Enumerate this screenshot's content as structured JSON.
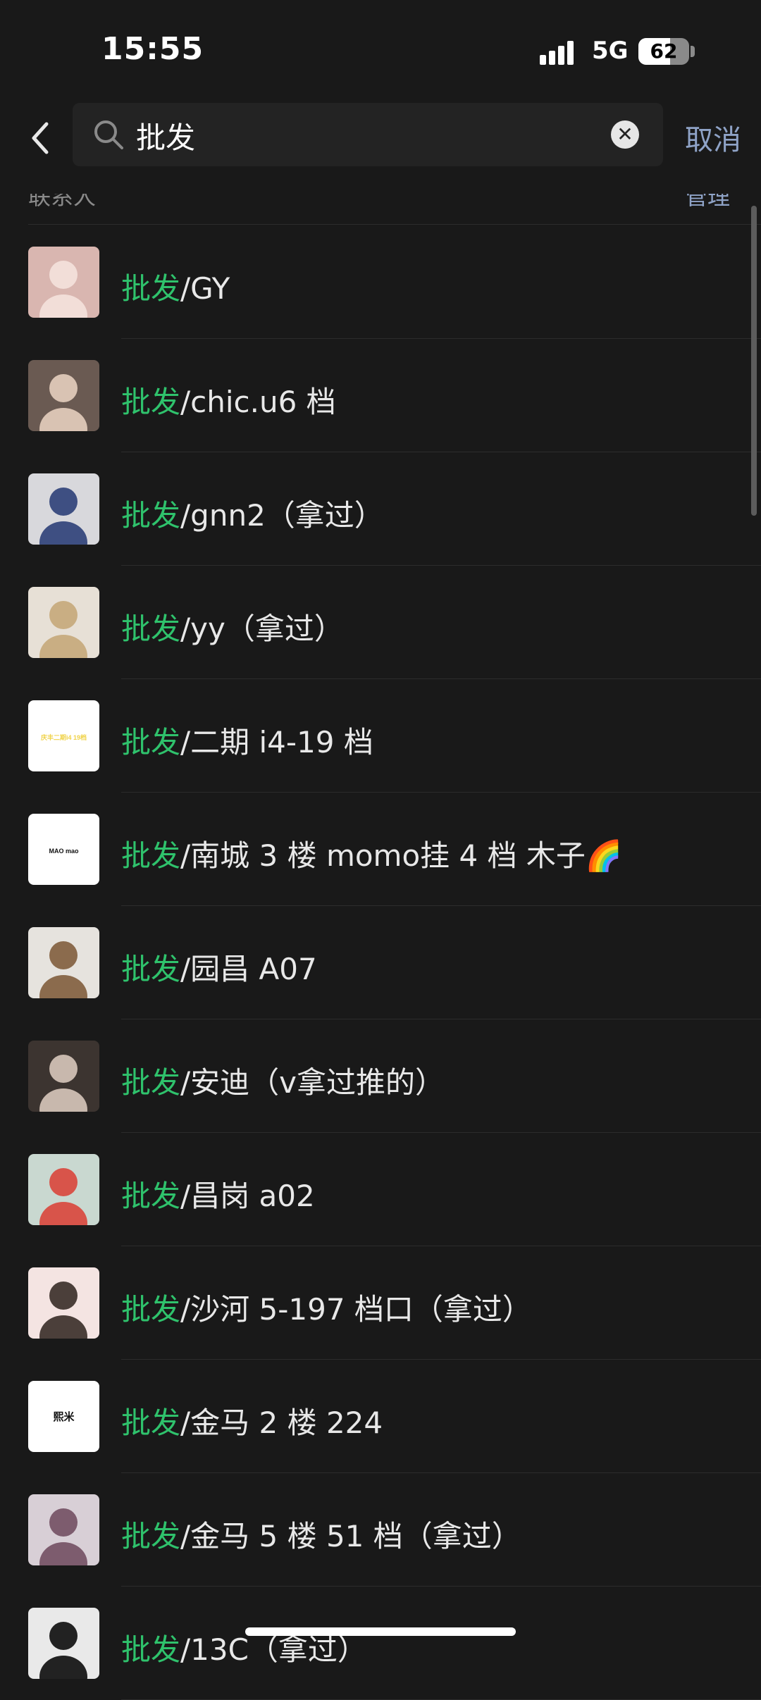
{
  "status_bar": {
    "time": "15:55",
    "network": "5G",
    "battery": "62",
    "battery_level": 0.62
  },
  "search": {
    "query": "批发",
    "cancel_label": "取消"
  },
  "section": {
    "title": "联系人",
    "manage_label": "管理"
  },
  "contacts": [
    {
      "highlight": "批发",
      "rest": "/GY",
      "avatar_bg": "#d9b6b0",
      "avatar_fg": "#f2ded8"
    },
    {
      "highlight": "批发",
      "rest": "/chic.u6 档",
      "avatar_bg": "#6a5a52",
      "avatar_fg": "#d9c3b3"
    },
    {
      "highlight": "批发",
      "rest": "/gnn2（拿过）",
      "avatar_bg": "#d8d8dc",
      "avatar_fg": "#3e4f82"
    },
    {
      "highlight": "批发",
      "rest": "/yy（拿过）",
      "avatar_bg": "#e7e0d6",
      "avatar_fg": "#c9ae83"
    },
    {
      "highlight": "批发",
      "rest": "/二期 i4-19 档",
      "avatar_bg": "#ffffff",
      "avatar_fg": "#f0d34a",
      "avatar_text": "庆丰二期i4 19档"
    },
    {
      "highlight": "批发",
      "rest": "/南城 3 楼 momo挂 4 档 木子🌈",
      "avatar_bg": "#ffffff",
      "avatar_fg": "#111111",
      "avatar_text": "MAO mao"
    },
    {
      "highlight": "批发",
      "rest": "/园昌 A07",
      "avatar_bg": "#e6e3de",
      "avatar_fg": "#8b6b4d"
    },
    {
      "highlight": "批发",
      "rest": "/安迪（v拿过推的）",
      "avatar_bg": "#3c3430",
      "avatar_fg": "#c8b8ad"
    },
    {
      "highlight": "批发",
      "rest": "/昌岗 a02",
      "avatar_bg": "#c9d8d0",
      "avatar_fg": "#d8544a"
    },
    {
      "highlight": "批发",
      "rest": "/沙河 5-197 档口（拿过）",
      "avatar_bg": "#f4e4e2",
      "avatar_fg": "#4b3f3a"
    },
    {
      "highlight": "批发",
      "rest": "/金马 2 楼 224",
      "avatar_bg": "#ffffff",
      "avatar_fg": "#111111",
      "avatar_text": "熙米"
    },
    {
      "highlight": "批发",
      "rest": "/金马 5 楼 51 档（拿过）",
      "avatar_bg": "#d8cfd6",
      "avatar_fg": "#7d5c6e"
    },
    {
      "highlight": "批发",
      "rest": "/13C（拿过）",
      "avatar_bg": "#e9e9e9",
      "avatar_fg": "#222222"
    }
  ]
}
